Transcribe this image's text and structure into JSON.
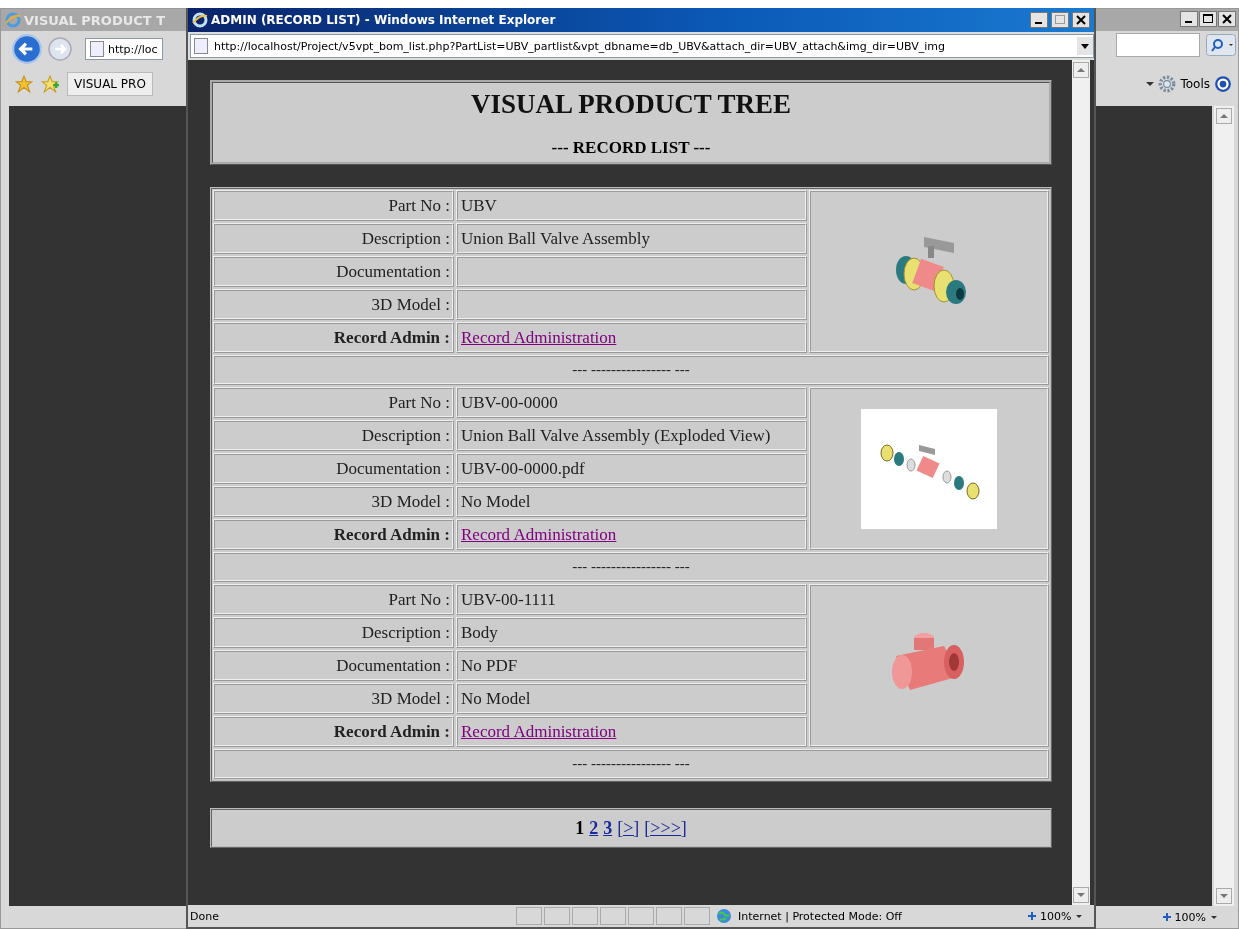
{
  "outer_window": {
    "title": "VISUAL PRODUCT T",
    "address": "http://loc",
    "tab": "VISUAL PRO",
    "tools_menu": "Tools",
    "zoom": "100%"
  },
  "popup": {
    "title": "ADMIN (RECORD LIST) - Windows Internet Explorer",
    "address": "http://localhost/Project/v5vpt_bom_list.php?PartList=UBV_partlist&vpt_dbname=db_UBV&attach_dir=UBV_attach&img_dir=UBV_img",
    "status": "Done",
    "zone": "Internet | Protected Mode: Off",
    "zoom": "100%"
  },
  "header": {
    "title": "VISUAL PRODUCT TREE",
    "subtitle": "--- RECORD LIST ---"
  },
  "records": [
    {
      "kind": "assembly",
      "separator": "--- ---------------- ---",
      "fields": [
        {
          "label": "Part No :",
          "value": "UBV",
          "kind": "text"
        },
        {
          "label": "Description :",
          "value": "Union Ball Valve Assembly",
          "kind": "text"
        },
        {
          "label": "Documentation :",
          "kind": "text"
        },
        {
          "label": "3D Model :",
          "kind": "text"
        },
        {
          "label": "Record Admin :",
          "value": "Record Administration",
          "kind": "link"
        }
      ]
    },
    {
      "kind": "exploded",
      "separator": "--- ---------------- ---",
      "fields": [
        {
          "label": "Part No :",
          "value": "UBV-00-0000",
          "kind": "text"
        },
        {
          "label": "Description :",
          "value": "Union Ball Valve Assembly (Exploded View)",
          "kind": "text"
        },
        {
          "label": "Documentation :",
          "value": "UBV-00-0000.pdf",
          "kind": "text"
        },
        {
          "label": "3D Model :",
          "value": "No Model",
          "kind": "text"
        },
        {
          "label": "Record Admin :",
          "value": "Record Administration",
          "kind": "link"
        }
      ]
    },
    {
      "kind": "body",
      "separator": "--- ---------------- ---",
      "fields": [
        {
          "label": "Part No :",
          "value": "UBV-00-1111",
          "kind": "text"
        },
        {
          "label": "Description :",
          "value": "Body",
          "kind": "text"
        },
        {
          "label": "Documentation :",
          "value": "No PDF",
          "kind": "text"
        },
        {
          "label": "3D Model :",
          "value": "No Model",
          "kind": "text"
        },
        {
          "label": "Record Admin :",
          "value": "Record Administration",
          "kind": "link"
        }
      ]
    }
  ],
  "pagination": [
    {
      "text": "1",
      "selected": true
    },
    {
      "text": "2",
      "selected": false
    },
    {
      "text": "3",
      "selected": false
    },
    {
      "text": "[>]",
      "selected": false
    },
    {
      "text": "[>>>]",
      "selected": false
    }
  ]
}
